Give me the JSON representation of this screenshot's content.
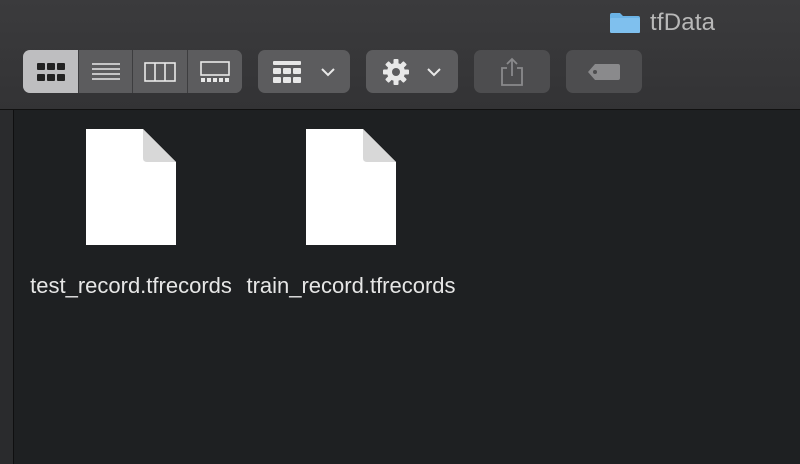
{
  "window": {
    "title": "tfData",
    "title_icon": "folder-icon"
  },
  "toolbar": {
    "view_modes": [
      {
        "name": "icon-view",
        "icon": "grid-icon",
        "active": true
      },
      {
        "name": "list-view",
        "icon": "list-icon",
        "active": false
      },
      {
        "name": "column-view",
        "icon": "columns-icon",
        "active": false
      },
      {
        "name": "gallery-view",
        "icon": "gallery-icon",
        "active": false
      }
    ],
    "group_button_icon": "group-grid-icon",
    "action_button_icon": "gear-icon",
    "share_button_icon": "share-icon",
    "tag_button_icon": "tag-icon"
  },
  "files": [
    {
      "name": "test_record.tfrecords",
      "icon": "document-icon"
    },
    {
      "name": "train_record.tfrecords",
      "icon": "document-icon"
    }
  ],
  "colors": {
    "folder": "#6bb3e6",
    "background": "#1e2022",
    "text": "#e6e6e6"
  }
}
